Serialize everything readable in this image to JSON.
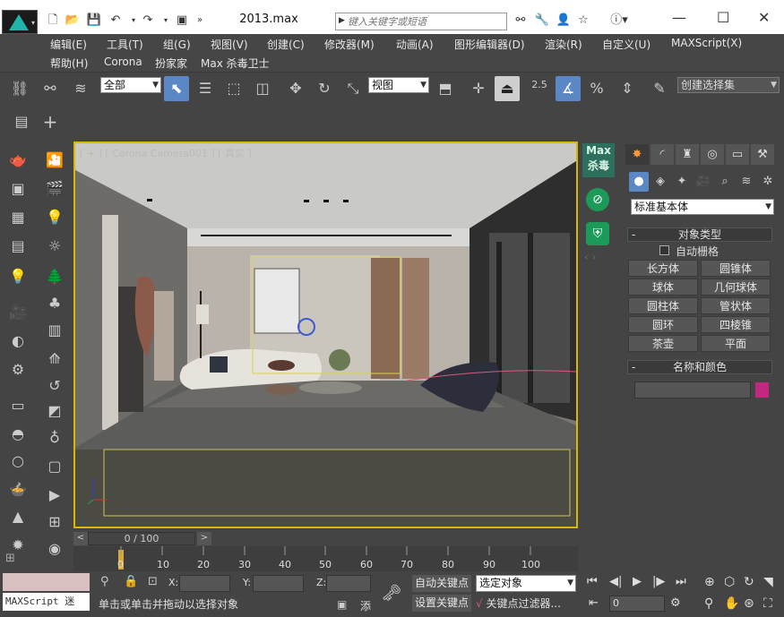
{
  "app": {
    "title": "2013.max",
    "search_placeholder": "键入关键字或短语"
  },
  "window_controls": {
    "minimize": "—",
    "maximize": "☐",
    "close": "✕"
  },
  "menus": [
    {
      "label": "编辑(E)"
    },
    {
      "label": "工具(T)"
    },
    {
      "label": "组(G)"
    },
    {
      "label": "视图(V)"
    },
    {
      "label": "创建(C)"
    },
    {
      "label": "修改器(M)"
    },
    {
      "label": "动画(A)"
    },
    {
      "label": "图形编辑器(D)"
    },
    {
      "label": "渲染(R)"
    },
    {
      "label": "自定义(U)"
    },
    {
      "label": "MAXScript(X)"
    },
    {
      "label": "帮助(H)"
    },
    {
      "label": "Corona"
    },
    {
      "label": "扮家家"
    },
    {
      "label": "Max 杀毒卫士"
    }
  ],
  "toolbar": {
    "selection_filter": "全部",
    "reference_coord": "视图",
    "snap_value": "2.5",
    "named_selection": "创建选择集"
  },
  "viewport": {
    "label": "[ + ] [ Corona Camera001 ] [ 真实 ]"
  },
  "max_antivirus": {
    "label_line1": "Max",
    "label_line2": "杀毒"
  },
  "command_panel": {
    "category": "标准基本体",
    "object_type_title": "对象类型",
    "autogrid_label": "自动栅格",
    "object_buttons": [
      "长方体",
      "圆锥体",
      "球体",
      "几何球体",
      "圆柱体",
      "管状体",
      "圆环",
      "四棱锥",
      "茶壶",
      "平面"
    ],
    "name_color_title": "名称和颜色",
    "swatch_color": "#c2297e"
  },
  "timeline": {
    "frame_counter": "0 / 100",
    "ticks": [
      "0",
      "10",
      "20",
      "30",
      "40",
      "50",
      "60",
      "70",
      "80",
      "90",
      "100"
    ]
  },
  "status": {
    "maxscript_label": "MAXScript 迷",
    "prompt": "单击或单击并拖动以选择对象",
    "x_label": "X:",
    "y_label": "Y:",
    "z_label": "Z:",
    "add_label": "添",
    "autokey": "自动关键点",
    "setkey": "设置关键点",
    "key_filter_dd": "选定对象",
    "key_filters": "关键点过滤器...",
    "frame_value": "0"
  }
}
